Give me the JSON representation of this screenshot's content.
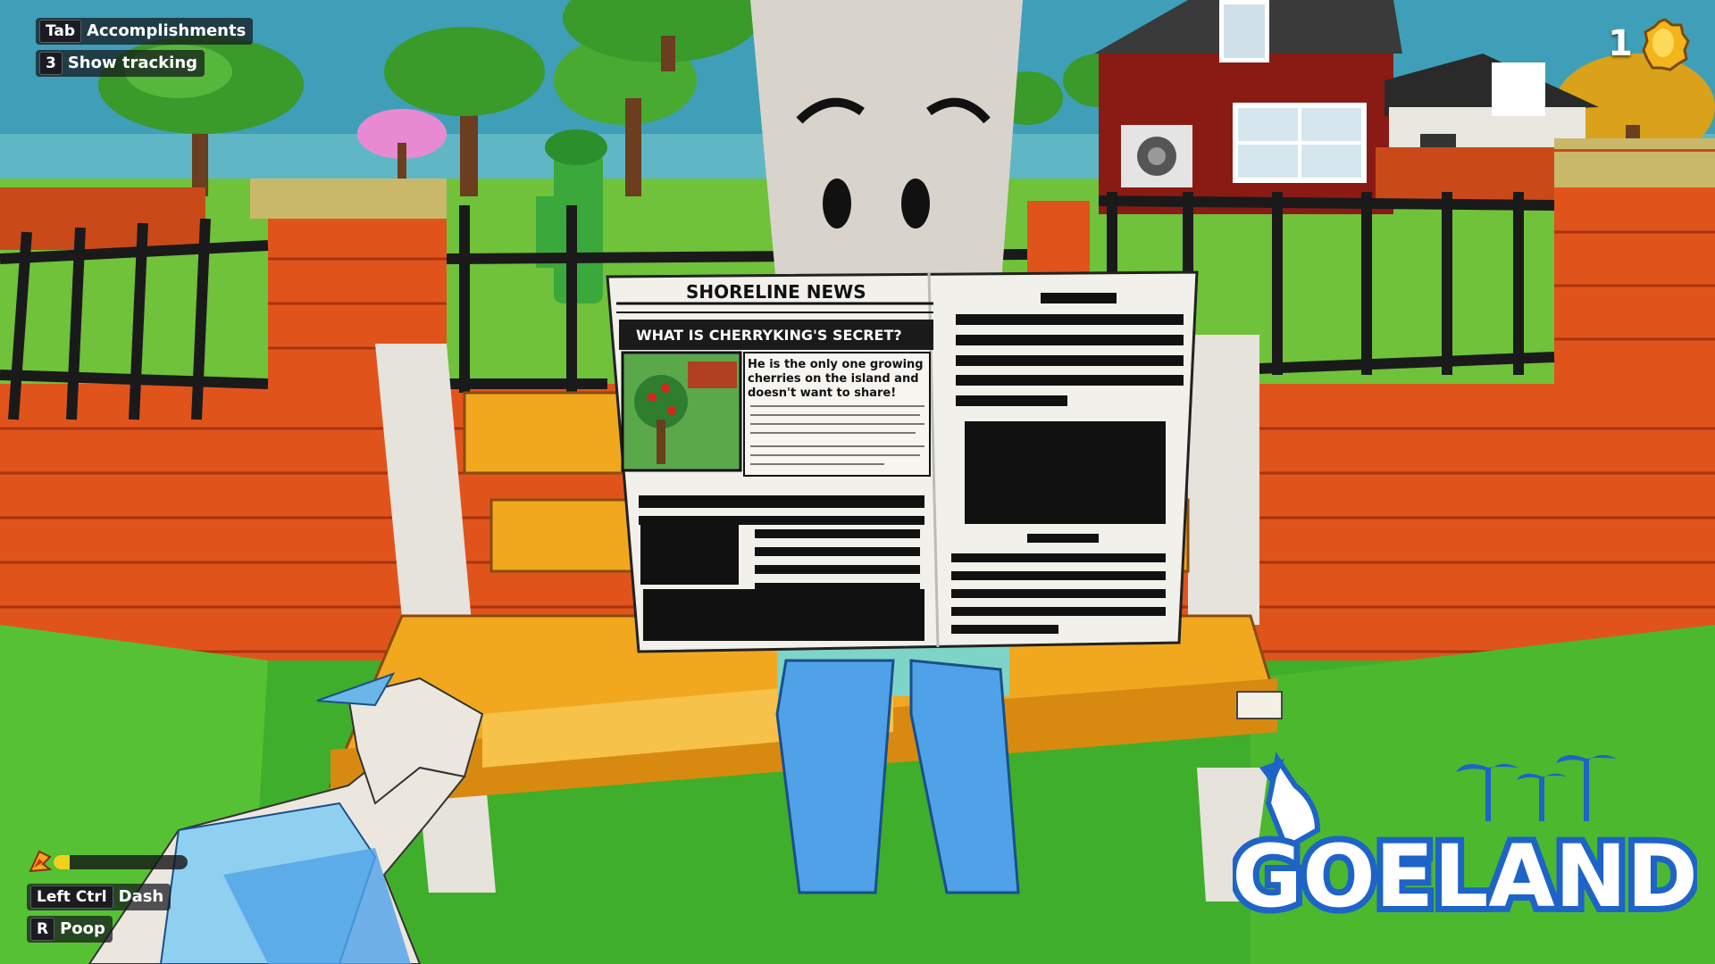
{
  "hud": {
    "top_left": [
      {
        "key": "Tab",
        "label": "Accomplishments"
      },
      {
        "key": "3",
        "label": "Show tracking"
      }
    ],
    "bottom_left": [
      {
        "key": "Left Ctrl",
        "label": "Dash"
      },
      {
        "key": "R",
        "label": "Poop"
      }
    ],
    "collectible_count": "1",
    "collectible_icon": "golden-egg-icon",
    "stamina_level": 0.12,
    "stamina_icon": "dash-feather-icon"
  },
  "newspaper": {
    "masthead": "SHORELINE NEWS",
    "headline": "WHAT IS CHERRYKING'S SECRET?",
    "lead": [
      "He is the only one growing",
      "cherries on the island and",
      "doesn't want to share!"
    ]
  },
  "logo": {
    "text": "GOELAND"
  },
  "colors": {
    "sky": "#3f9fb8",
    "brick": "#e0541c",
    "grass": "#3fae2a",
    "bench": "#f2a81e",
    "jeans": "#4fa2e8",
    "logo_blue": "#1e63c8"
  }
}
